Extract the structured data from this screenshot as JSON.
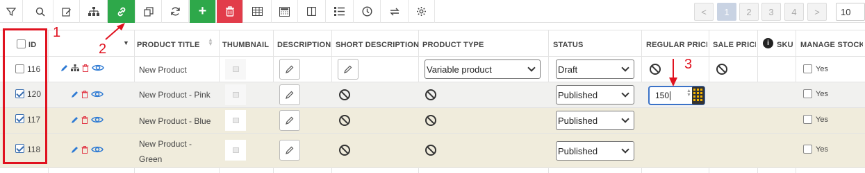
{
  "toolbar": {
    "icons": [
      "filter-icon",
      "search-icon",
      "edit-icon",
      "hierarchy-icon",
      "link-icon",
      "duplicate-icon",
      "refresh-icon",
      "plus-icon",
      "trash-icon",
      "table-icon",
      "calculator-icon",
      "columns-icon",
      "list-icon",
      "history-icon",
      "swap-icon",
      "settings-icon"
    ],
    "add_label": "+"
  },
  "pagination": {
    "prev": "<",
    "pages": [
      "1",
      "2",
      "3",
      "4"
    ],
    "next": ">",
    "active_page": "1",
    "per_page": "10"
  },
  "columns": {
    "id": "ID",
    "product_title": "PRODUCT TITLE",
    "thumbnail": "THUMBNAIL",
    "description": "DESCRIPTION",
    "short_description": "SHORT DESCRIPTION",
    "product_type": "PRODUCT TYPE",
    "status": "STATUS",
    "regular_price": "REGULAR PRICE",
    "sale_price": "SALE PRICE",
    "sku": "SKU",
    "manage_stock": "MANAGE STOCK"
  },
  "rows": [
    {
      "id": "116",
      "checked": false,
      "title": "New Product",
      "product_type": "Variable product",
      "status": "Draft",
      "regular_price": "",
      "manage_stock": "Yes"
    },
    {
      "id": "120",
      "checked": true,
      "title": "New Product - Pink",
      "product_type": "",
      "status": "Published",
      "regular_price": "150",
      "manage_stock": "Yes"
    },
    {
      "id": "117",
      "checked": true,
      "title": "New Product - Blue",
      "product_type": "",
      "status": "Published",
      "regular_price": "",
      "manage_stock": "Yes"
    },
    {
      "id": "118",
      "checked": true,
      "title_line1": "New Product -",
      "title_line2": "Green",
      "product_type": "",
      "status": "Published",
      "regular_price": "",
      "manage_stock": "Yes"
    }
  ],
  "annotations": [
    "1",
    "2",
    "3"
  ],
  "colors": {
    "green": "#2ea84a",
    "red": "#e23c4a",
    "annotation": "#e0121f",
    "focus": "#3a72c8"
  }
}
